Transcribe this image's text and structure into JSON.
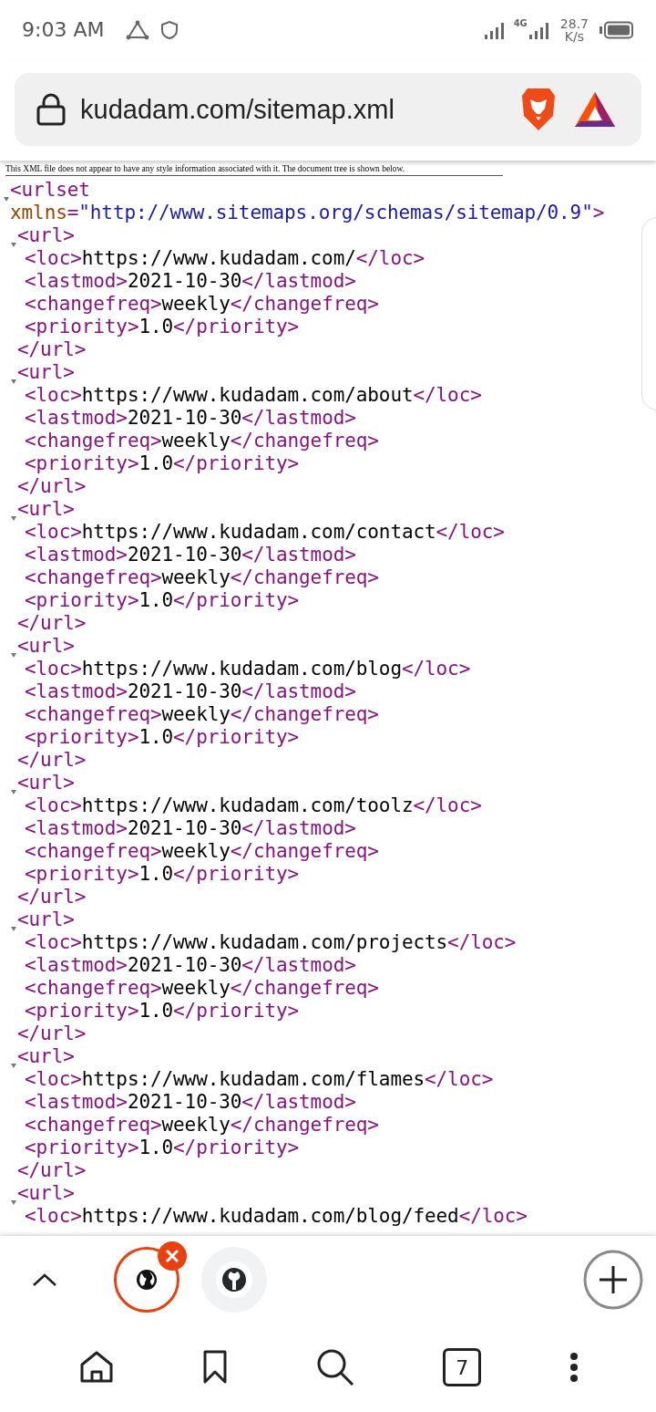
{
  "status_bar": {
    "time": "9:03 AM",
    "network": "4G",
    "speed": "28.7",
    "speed_unit": "K/s"
  },
  "address_bar": {
    "url": "kudadam.com/sitemap.xml"
  },
  "xml_notice": "This XML file does not appear to have any style information associated with it. The document tree is shown below.",
  "xml": {
    "open": "<urlset",
    "attr_name": "xmlns",
    "attr_eq": "=",
    "attr_value": "\"http://www.sitemaps.org/schemas/sitemap/0.9\"",
    "open_end": ">",
    "entries": [
      {
        "open": "<url>",
        "close": "</url>",
        "children": [
          {
            "open": "<loc>",
            "text": "https://www.kudadam.com/",
            "close": "</loc>"
          },
          {
            "open": "<lastmod>",
            "text": "2021-10-30",
            "close": "</lastmod>"
          },
          {
            "open": "<changefreq>",
            "text": "weekly",
            "close": "</changefreq>"
          },
          {
            "open": "<priority>",
            "text": "1.0",
            "close": "</priority>"
          }
        ]
      },
      {
        "open": "<url>",
        "close": "</url>",
        "children": [
          {
            "open": "<loc>",
            "text": "https://www.kudadam.com/about",
            "close": "</loc>"
          },
          {
            "open": "<lastmod>",
            "text": "2021-10-30",
            "close": "</lastmod>"
          },
          {
            "open": "<changefreq>",
            "text": "weekly",
            "close": "</changefreq>"
          },
          {
            "open": "<priority>",
            "text": "1.0",
            "close": "</priority>"
          }
        ]
      },
      {
        "open": "<url>",
        "close": "</url>",
        "children": [
          {
            "open": "<loc>",
            "text": "https://www.kudadam.com/contact",
            "close": "</loc>"
          },
          {
            "open": "<lastmod>",
            "text": "2021-10-30",
            "close": "</lastmod>"
          },
          {
            "open": "<changefreq>",
            "text": "weekly",
            "close": "</changefreq>"
          },
          {
            "open": "<priority>",
            "text": "1.0",
            "close": "</priority>"
          }
        ]
      },
      {
        "open": "<url>",
        "close": "</url>",
        "children": [
          {
            "open": "<loc>",
            "text": "https://www.kudadam.com/blog",
            "close": "</loc>"
          },
          {
            "open": "<lastmod>",
            "text": "2021-10-30",
            "close": "</lastmod>"
          },
          {
            "open": "<changefreq>",
            "text": "weekly",
            "close": "</changefreq>"
          },
          {
            "open": "<priority>",
            "text": "1.0",
            "close": "</priority>"
          }
        ]
      },
      {
        "open": "<url>",
        "close": "</url>",
        "children": [
          {
            "open": "<loc>",
            "text": "https://www.kudadam.com/toolz",
            "close": "</loc>"
          },
          {
            "open": "<lastmod>",
            "text": "2021-10-30",
            "close": "</lastmod>"
          },
          {
            "open": "<changefreq>",
            "text": "weekly",
            "close": "</changefreq>"
          },
          {
            "open": "<priority>",
            "text": "1.0",
            "close": "</priority>"
          }
        ]
      },
      {
        "open": "<url>",
        "close": "</url>",
        "children": [
          {
            "open": "<loc>",
            "text": "https://www.kudadam.com/projects",
            "close": "</loc>"
          },
          {
            "open": "<lastmod>",
            "text": "2021-10-30",
            "close": "</lastmod>"
          },
          {
            "open": "<changefreq>",
            "text": "weekly",
            "close": "</changefreq>"
          },
          {
            "open": "<priority>",
            "text": "1.0",
            "close": "</priority>"
          }
        ]
      },
      {
        "open": "<url>",
        "close": "</url>",
        "children": [
          {
            "open": "<loc>",
            "text": "https://www.kudadam.com/flames",
            "close": "</loc>"
          },
          {
            "open": "<lastmod>",
            "text": "2021-10-30",
            "close": "</lastmod>"
          },
          {
            "open": "<changefreq>",
            "text": "weekly",
            "close": "</changefreq>"
          },
          {
            "open": "<priority>",
            "text": "1.0",
            "close": "</priority>"
          }
        ]
      },
      {
        "open": "<url>",
        "children": [
          {
            "open": "<loc>",
            "text": "https://www.kudadam.com/blog/feed",
            "close": "</loc>"
          }
        ]
      }
    ]
  },
  "tab_strip": {
    "tabs": [
      {
        "kind": "globe",
        "selected": true,
        "closable": true
      },
      {
        "kind": "github",
        "selected": false,
        "closable": false
      }
    ]
  },
  "toolbar": {
    "tab_count": "7"
  }
}
